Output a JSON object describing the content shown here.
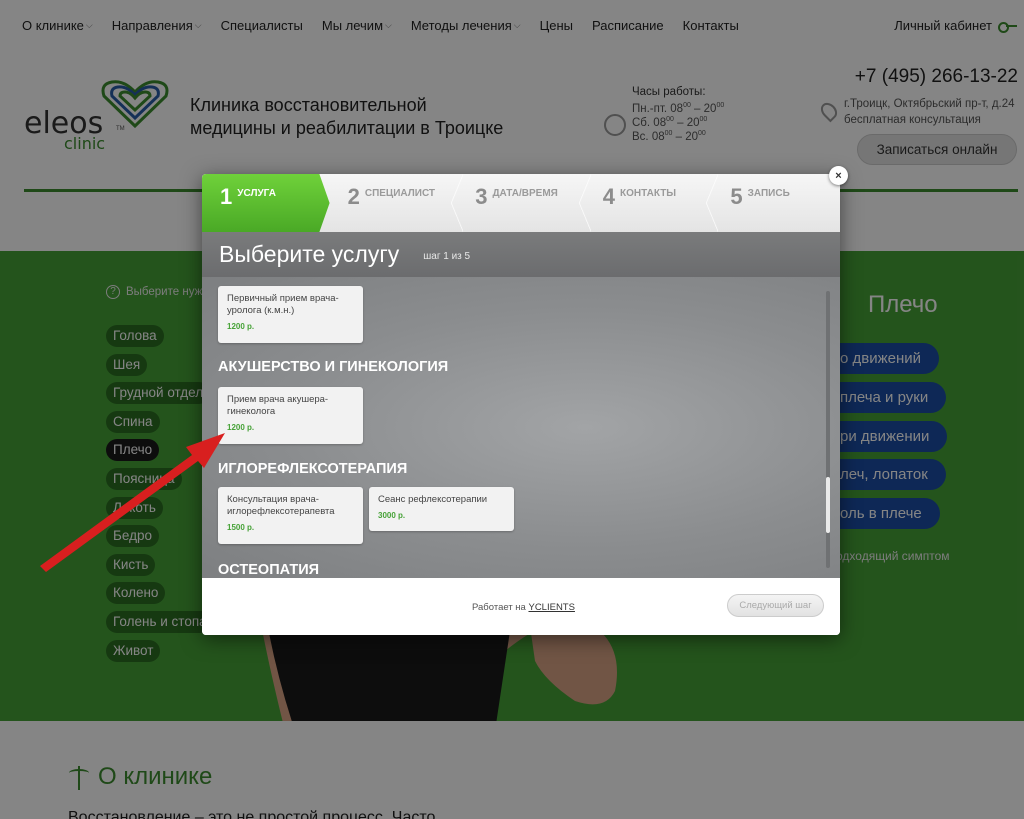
{
  "nav": {
    "items": [
      {
        "label": "О клинике",
        "chevron": true
      },
      {
        "label": "Направления",
        "chevron": true
      },
      {
        "label": "Специалисты",
        "chevron": false
      },
      {
        "label": "Мы лечим",
        "chevron": true
      },
      {
        "label": "Методы лечения",
        "chevron": true
      },
      {
        "label": "Цены",
        "chevron": false
      },
      {
        "label": "Расписание",
        "chevron": false
      },
      {
        "label": "Контакты",
        "chevron": false
      }
    ],
    "cabinet_label": "Личный кабинет"
  },
  "header": {
    "logo_text": "eleos",
    "logo_sub": "clinic",
    "logo_tm": "TM",
    "tagline_line1": "Клиника восстановительной",
    "tagline_line2": "медицины и реабилитации в Троицке",
    "hours_title": "Часы работы:",
    "hours": [
      {
        "days": "Пн.-пт.",
        "from": "08",
        "to": "20",
        "sup": "00"
      },
      {
        "days": "Сб.",
        "from": "08",
        "to": "20",
        "sup": "00"
      },
      {
        "days": "Вс.",
        "from": "08",
        "to": "20",
        "sup": "00"
      }
    ],
    "phone": "+7 (495) 266-13-22",
    "address_line1": "г.Троицк, Октябрьский пр-т, д.24",
    "address_line2": "бесплатная консультация",
    "signup_label": "Записаться онлайн"
  },
  "hero": {
    "help_text": "Выберите нуж",
    "body_parts": [
      {
        "label": "Голова",
        "active": false
      },
      {
        "label": "Шея",
        "active": false
      },
      {
        "label": "Грудной отдел",
        "active": false
      },
      {
        "label": "Спина",
        "active": false
      },
      {
        "label": "Плечо",
        "active": true
      },
      {
        "label": "Поясница",
        "active": false
      },
      {
        "label": "Локоть",
        "active": false
      },
      {
        "label": "Бедро",
        "active": false
      },
      {
        "label": "Кисть",
        "active": false
      },
      {
        "label": "Колено",
        "active": false
      },
      {
        "label": "Голень и стопа",
        "active": false
      },
      {
        "label": "Живот",
        "active": false
      }
    ],
    "right_title": "Плечо",
    "symptoms": [
      "о движений",
      "плеча и руки",
      "ри движении",
      "леч, лопаток",
      "оль в плече"
    ],
    "not_found": "одходящий симптом"
  },
  "about": {
    "title": "О клинике",
    "text": "Восстановление – это не простой процесс. Часто"
  },
  "modal": {
    "steps": [
      {
        "num": "1",
        "label": "Услуга",
        "active": true
      },
      {
        "num": "2",
        "label": "Специалист",
        "active": false
      },
      {
        "num": "3",
        "label": "Дата/время",
        "active": false
      },
      {
        "num": "4",
        "label": "Контакты",
        "active": false
      },
      {
        "num": "5",
        "label": "Запись",
        "active": false
      }
    ],
    "title": "Выберите услугу",
    "step_info": "шаг 1 из 5",
    "services": {
      "urology_card": {
        "name": "Первичный прием врача-уролога (к.м.н.)",
        "price": "1200 р."
      },
      "cat_gyn": "АКУШЕРСТВО И ГИНЕКОЛОГИЯ",
      "gyn_card": {
        "name": "Прием врача акушера-гинеколога",
        "price": "1200 р."
      },
      "cat_reflex": "ИГЛОРЕФЛЕКСОТЕРАПИЯ",
      "reflex_card1": {
        "name": "Консультация врача-иглорефлексотерапевта",
        "price": "1500 р."
      },
      "reflex_card2": {
        "name": "Сеанс рефлексотерапии",
        "price": "3000 р."
      },
      "cat_osteo": "ОСТЕОПАТИЯ"
    },
    "powered_prefix": "Работает на",
    "powered_link": "YCLIENTS",
    "next_label": "Следующий шаг",
    "close_symbol": "×"
  },
  "colors": {
    "brand_green": "#46a237",
    "step_active": "#5cbf2f",
    "price_green": "#46a237",
    "symptom_blue": "#1b4ea5",
    "arrow_red": "#d81f1f"
  }
}
